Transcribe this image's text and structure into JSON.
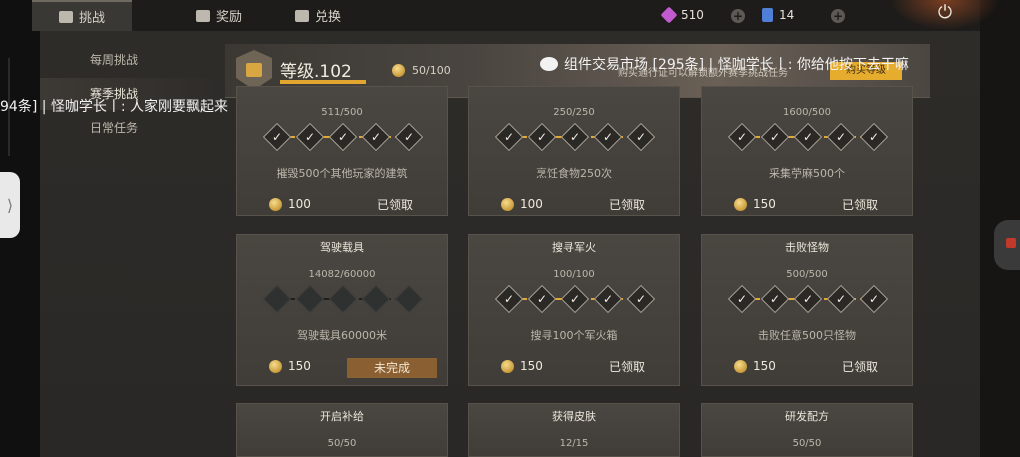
{
  "tabs": [
    {
      "label": "挑战",
      "icon": "challenge-icon"
    },
    {
      "label": "奖励",
      "icon": "reward-icon"
    },
    {
      "label": "兑换",
      "icon": "exchange-icon"
    }
  ],
  "currency": {
    "gems": "510",
    "cards": "14"
  },
  "nav": {
    "weekly": "每周挑战",
    "season": "赛季挑战",
    "daily": "日常任务"
  },
  "banner": {
    "level": "等级.102",
    "progress": "50/100",
    "hint": "购买通行证可以解锁额外赛季挑战任务",
    "button": "购买等级"
  },
  "overlay": {
    "left": "94条] | 怪咖学长丨: 人家刚要飘起来",
    "right": "组件交易市场 [295条] | 怪咖学长丨: 你给他按下去干嘛"
  },
  "cards": [
    {
      "title": "",
      "progress": "511/500",
      "desc": "摧毁500个其他玩家的建筑",
      "reward": "100",
      "status": "已领取",
      "complete": true
    },
    {
      "title": "",
      "progress": "250/250",
      "desc": "烹饪食物250次",
      "reward": "100",
      "status": "已领取",
      "complete": true
    },
    {
      "title": "",
      "progress": "1600/500",
      "desc": "采集苧麻500个",
      "reward": "150",
      "status": "已领取",
      "complete": true
    },
    {
      "title": "驾驶载具",
      "progress": "14082/60000",
      "desc": "驾驶载具60000米",
      "reward": "150",
      "status": "未完成",
      "complete": false
    },
    {
      "title": "搜寻军火",
      "progress": "100/100",
      "desc": "搜寻100个军火箱",
      "reward": "150",
      "status": "已领取",
      "complete": true
    },
    {
      "title": "击败怪物",
      "progress": "500/500",
      "desc": "击败任意500只怪物",
      "reward": "150",
      "status": "已领取",
      "complete": true
    },
    {
      "title": "开启补给",
      "progress": "50/50",
      "desc": "",
      "reward": "",
      "status": "",
      "complete": true
    },
    {
      "title": "获得皮肤",
      "progress": "12/15",
      "desc": "",
      "reward": "",
      "status": "",
      "complete": true
    },
    {
      "title": "研发配方",
      "progress": "50/50",
      "desc": "",
      "reward": "",
      "status": "",
      "complete": true
    }
  ],
  "colors": {
    "accent": "#e3aa33",
    "incomplete_button": "#8a5f32"
  }
}
